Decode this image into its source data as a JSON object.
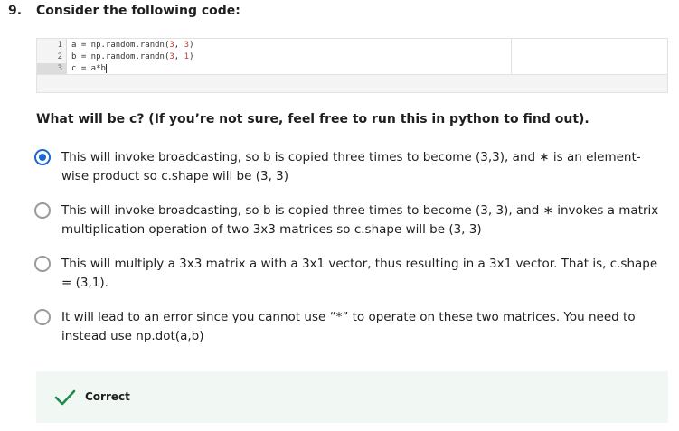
{
  "question": {
    "number": "9.",
    "title": "Consider the following code:"
  },
  "code": {
    "line_numbers": [
      "1",
      "2",
      "3"
    ],
    "lines": [
      {
        "pre": "a = np.random.randn(",
        "n1": "3",
        "mid": ", ",
        "n2": "3",
        "post": ")"
      },
      {
        "pre": "b = np.random.randn(",
        "n1": "3",
        "mid": ", ",
        "n2": "1",
        "post": ")"
      },
      {
        "pre": "c = a*b",
        "n1": "",
        "mid": "",
        "n2": "",
        "post": ""
      }
    ]
  },
  "prompt": "What will be c? (If you’re not sure, feel free to run this in python to find out).",
  "options": [
    {
      "text": "This will invoke broadcasting, so b is copied three times to become (3,3), and ∗ is an element-wise product so c.shape will be (3, 3)",
      "selected": true
    },
    {
      "text": "This will invoke broadcasting, so b is copied three times to become (3, 3), and ∗ invokes a matrix multiplication operation of two 3x3 matrices so c.shape will be (3, 3)",
      "selected": false
    },
    {
      "text": "This will multiply a 3x3 matrix a with a 3x1 vector, thus resulting in a 3x1 vector. That is, c.shape = (3,1).",
      "selected": false
    },
    {
      "text": "It will lead to an error since you cannot use “*” to operate on these two matrices. You need to instead use np.dot(a,b)",
      "selected": false
    }
  ],
  "feedback": {
    "icon": "checkmark-icon",
    "label": "Correct",
    "color": "#1e8a4c"
  },
  "colors": {
    "accent": "#1a66d2",
    "feedback_bg": "#f1f8f3"
  }
}
